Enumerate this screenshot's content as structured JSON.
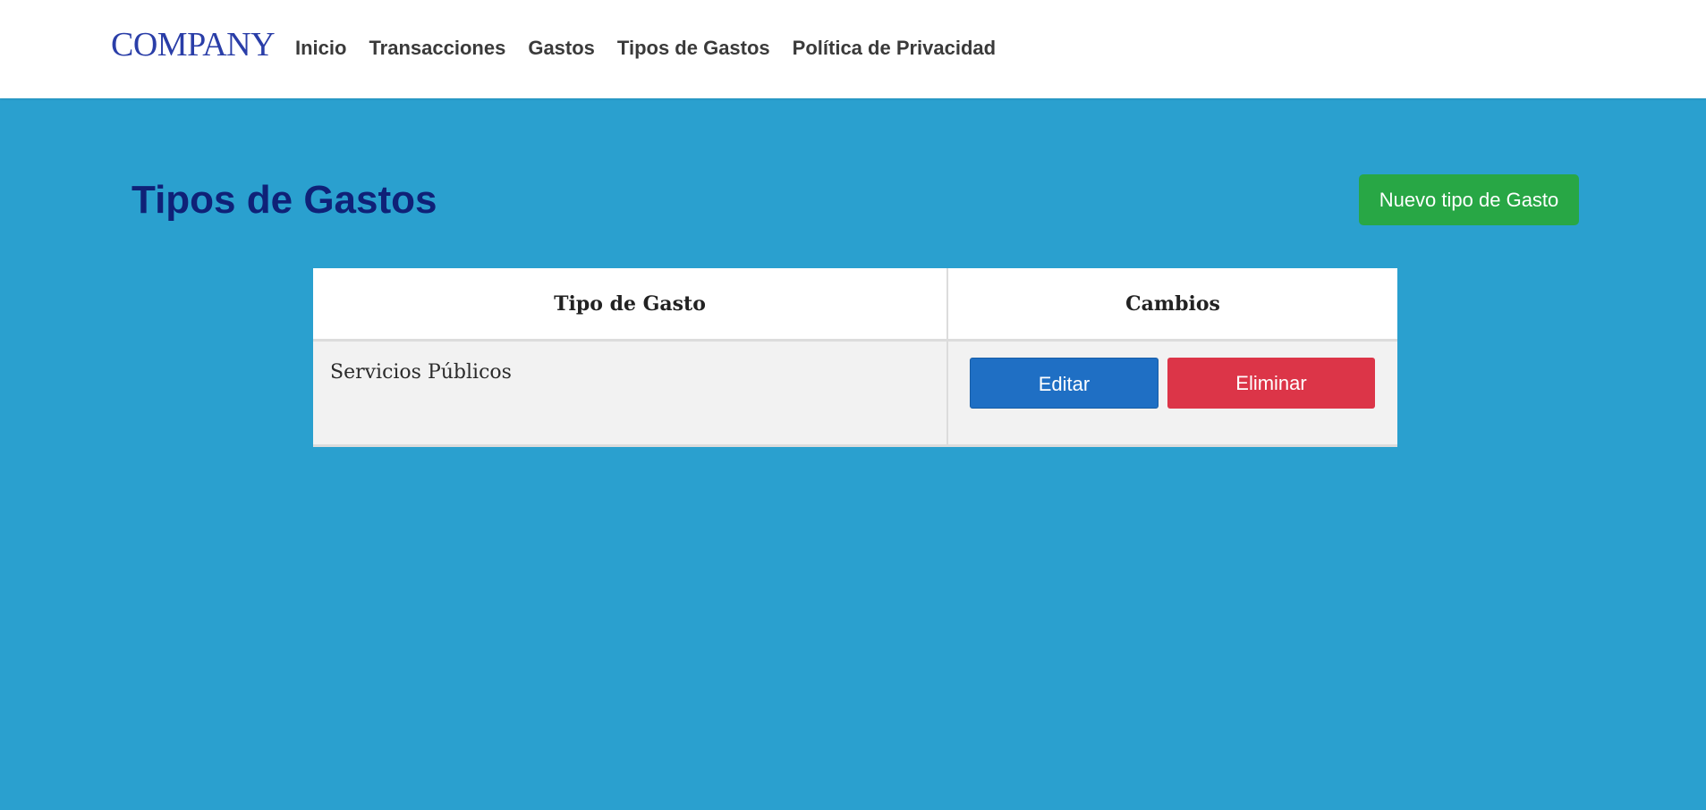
{
  "navbar": {
    "brand": "COMPANY",
    "links": [
      "Inicio",
      "Transacciones",
      "Gastos",
      "Tipos de Gastos",
      "Política de Privacidad"
    ]
  },
  "page": {
    "title": "Tipos de Gastos",
    "new_button_label": "Nuevo tipo de Gasto"
  },
  "table": {
    "headers": [
      "Tipo de Gasto",
      "Cambios"
    ],
    "rows": [
      {
        "tipo": "Servicios Públicos",
        "edit_label": "Editar",
        "delete_label": "Eliminar"
      }
    ]
  },
  "colors": {
    "background": "#2aa0cf",
    "navbar": "#ffffff",
    "brand": "#2a3ea8",
    "title": "#0f2177",
    "new_button": "#28a745",
    "edit_button": "#1f6fc4",
    "delete_button": "#dc3548"
  }
}
